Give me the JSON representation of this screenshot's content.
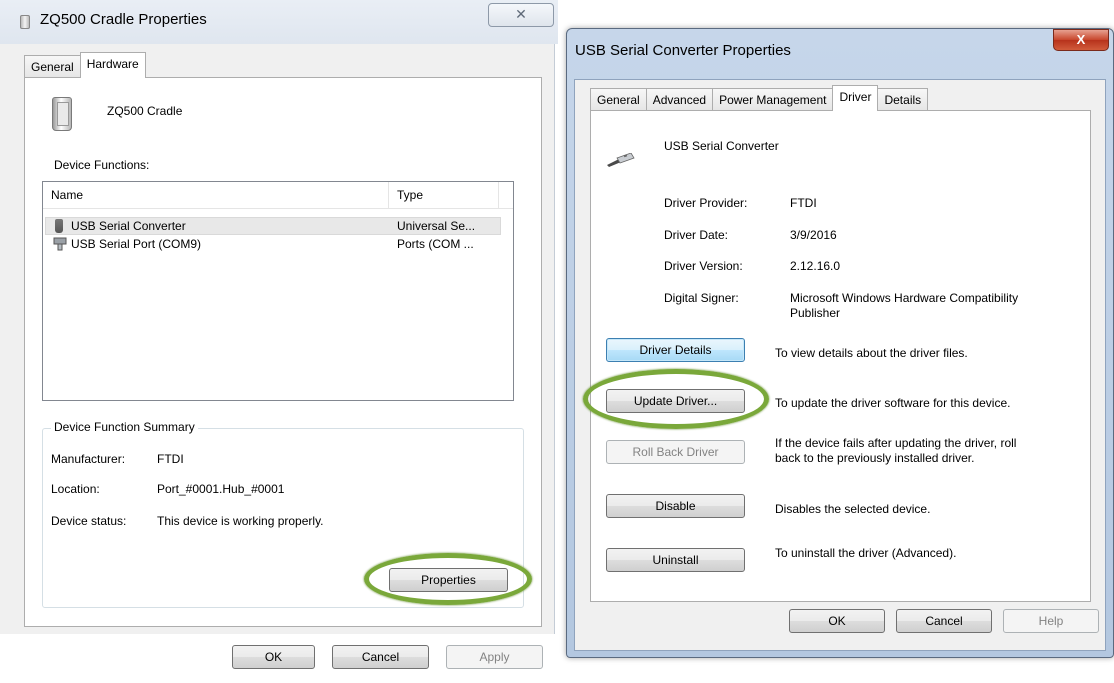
{
  "left_dialog": {
    "title": "ZQ500 Cradle Properties",
    "close_glyph": "✕",
    "tabs": [
      "General",
      "Hardware"
    ],
    "device_name": "ZQ500 Cradle",
    "device_functions_label": "Device Functions:",
    "columns": [
      "Name",
      "Type"
    ],
    "rows": [
      {
        "name": "USB Serial Converter",
        "type": "Universal Se...",
        "icon": "usb-plug-icon"
      },
      {
        "name": "USB Serial Port (COM9)",
        "type": "Ports (COM ...",
        "icon": "serial-port-icon"
      }
    ],
    "summary": {
      "legend": "Device Function Summary",
      "manufacturer_label": "Manufacturer:",
      "manufacturer_value": "FTDI",
      "location_label": "Location:",
      "location_value": "Port_#0001.Hub_#0001",
      "status_label": "Device status:",
      "status_value": "This device is working properly."
    },
    "properties_button": "Properties",
    "ok_button": "OK",
    "cancel_button": "Cancel",
    "apply_button": "Apply"
  },
  "right_dialog": {
    "title": "USB Serial Converter Properties",
    "close_glyph": "X",
    "tabs": [
      "General",
      "Advanced",
      "Power Management",
      "Driver",
      "Details"
    ],
    "device_name": "USB Serial Converter",
    "info": {
      "provider_label": "Driver Provider:",
      "provider_value": "FTDI",
      "date_label": "Driver Date:",
      "date_value": "3/9/2016",
      "version_label": "Driver Version:",
      "version_value": "2.12.16.0",
      "signer_label": "Digital Signer:",
      "signer_value_line1": "Microsoft Windows Hardware Compatibility",
      "signer_value_line2": "Publisher"
    },
    "actions": {
      "driver_details": {
        "label": "Driver Details",
        "desc": "To view details about the driver files."
      },
      "update_driver": {
        "label": "Update Driver...",
        "desc": "To update the driver software for this device."
      },
      "roll_back": {
        "label": "Roll Back Driver",
        "desc_line1": "If the device fails after updating the driver, roll",
        "desc_line2": "back to the previously installed driver."
      },
      "disable": {
        "label": "Disable",
        "desc": "Disables the selected device."
      },
      "uninstall": {
        "label": "Uninstall",
        "desc": "To uninstall the driver (Advanced)."
      }
    },
    "ok_button": "OK",
    "cancel_button": "Cancel",
    "help_button": "Help"
  },
  "colors": {
    "highlight": "#7aa83a",
    "close_red": "#c7452b",
    "window_bg": "#f0f0f0"
  }
}
